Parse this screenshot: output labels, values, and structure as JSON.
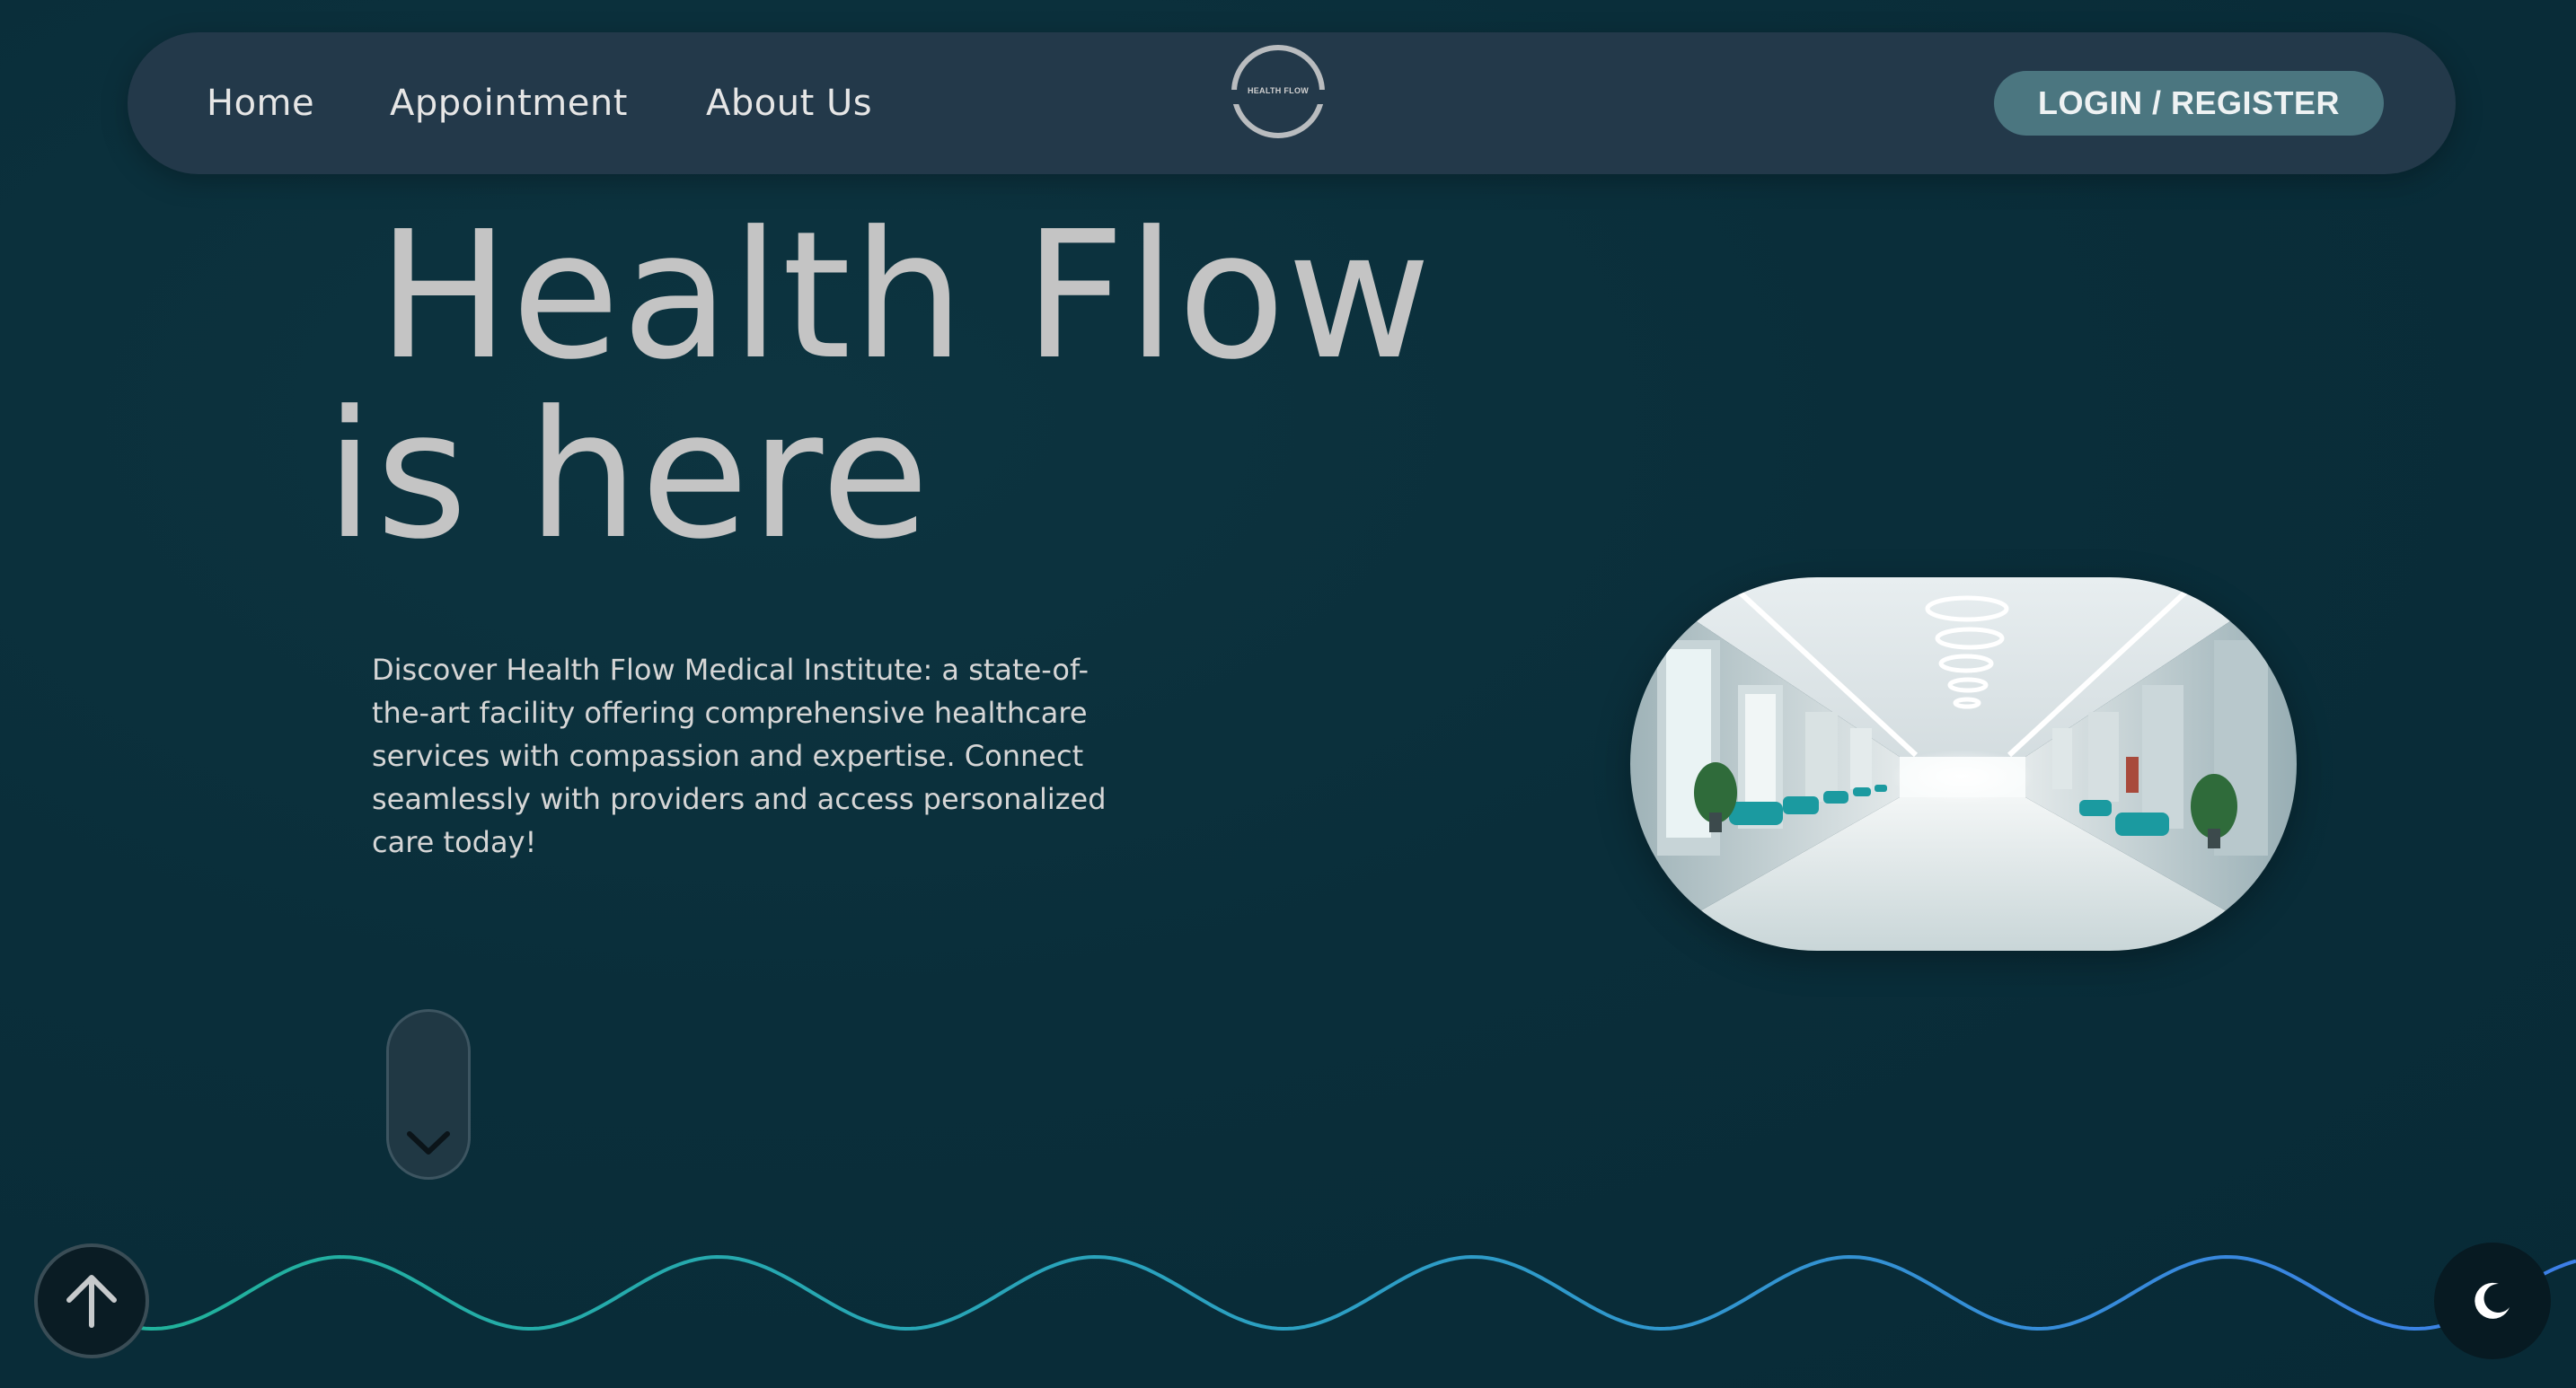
{
  "nav": {
    "links": [
      {
        "label": "Home"
      },
      {
        "label": "Appointment"
      },
      {
        "label": "About Us"
      }
    ],
    "logo_text": "HEALTH FLOW",
    "login_label": "LOGIN / REGISTER"
  },
  "hero": {
    "title_line1": "Health Flow",
    "title_line2": "is here",
    "description": "Discover Health Flow Medical Institute: a state-of-the-art facility offering comprehensive healthcare services with compassion and expertise. Connect seamlessly with providers and access personalized care today!",
    "image_subject": "hospital corridor"
  },
  "icons": {
    "scroll_down": "chevron-down-icon",
    "back_to_top": "arrow-up-icon",
    "theme_toggle": "moon-icon",
    "logo": "circle-logo-icon"
  },
  "colors": {
    "background": "#0a2e3a",
    "navbar": "#23394a",
    "login_button": "#4b7680",
    "wave_start": "#20b39a",
    "wave_end": "#3d7fe8",
    "heading_text": "#c4c4c4"
  }
}
